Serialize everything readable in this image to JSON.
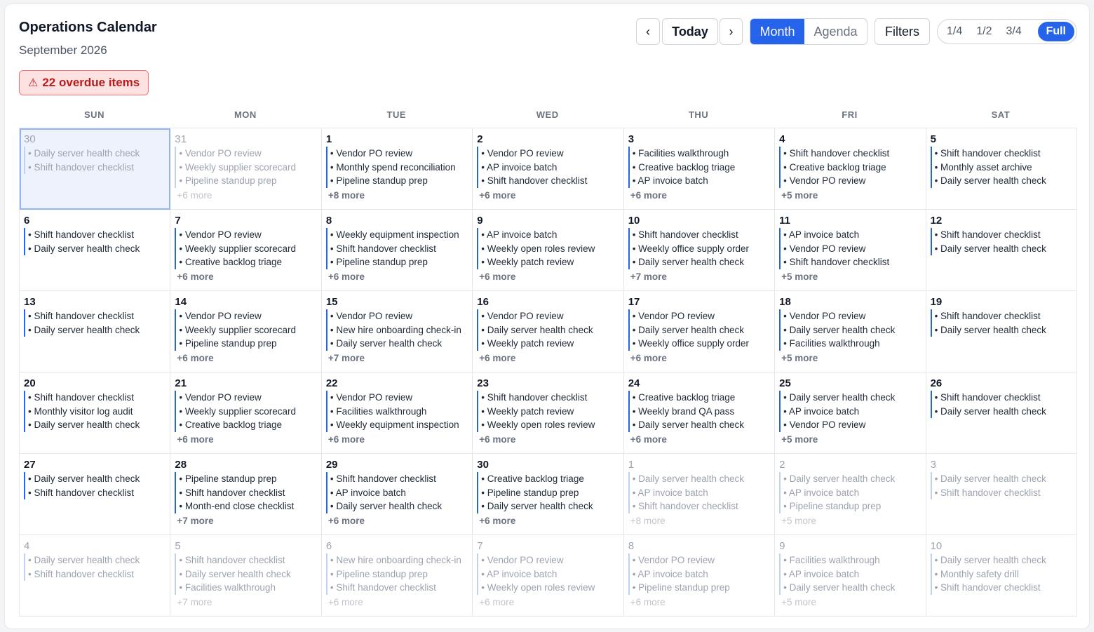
{
  "header": {
    "title": "Operations Calendar",
    "subtitle": "September 2026"
  },
  "alert": {
    "icon": "⚠",
    "text": "22 overdue items"
  },
  "toolbar": {
    "prev": "‹",
    "today": "Today",
    "next": "›",
    "views": [
      "Month",
      "Agenda"
    ],
    "active_view": "Month",
    "filters": "Filters",
    "zoom": [
      "1/4",
      "1/2",
      "3/4",
      "Full"
    ],
    "active_zoom": "Full"
  },
  "colors": {
    "accent": "#2563eb",
    "overdue_bg": "#fee2e2",
    "overdue_text": "#b91c1c"
  },
  "weekdays": [
    "SUN",
    "MON",
    "TUE",
    "WED",
    "THU",
    "FRI",
    "SAT"
  ],
  "days": [
    {
      "d": "30",
      "dim": true,
      "selected": true,
      "events": [
        "Daily server health check",
        "Shift handover checklist"
      ],
      "more": ""
    },
    {
      "d": "31",
      "dim": true,
      "events": [
        "Vendor PO review",
        "Weekly supplier scorecard",
        "Pipeline standup prep"
      ],
      "more": "+6 more"
    },
    {
      "d": "1",
      "events": [
        "Vendor PO review",
        "Monthly spend reconciliation",
        "Pipeline standup prep"
      ],
      "more": "+8 more"
    },
    {
      "d": "2",
      "events": [
        "Vendor PO review",
        "AP invoice batch",
        "Shift handover checklist"
      ],
      "more": "+6 more"
    },
    {
      "d": "3",
      "events": [
        "Facilities walkthrough",
        "Creative backlog triage",
        "AP invoice batch"
      ],
      "more": "+6 more"
    },
    {
      "d": "4",
      "events": [
        "Shift handover checklist",
        "Creative backlog triage",
        "Vendor PO review"
      ],
      "more": "+5 more"
    },
    {
      "d": "5",
      "events": [
        "Shift handover checklist",
        "Monthly asset archive",
        "Daily server health check"
      ],
      "more": ""
    },
    {
      "d": "6",
      "events": [
        "Shift handover checklist",
        "Daily server health check"
      ],
      "more": ""
    },
    {
      "d": "7",
      "events": [
        "Vendor PO review",
        "Weekly supplier scorecard",
        "Creative backlog triage"
      ],
      "more": "+6 more"
    },
    {
      "d": "8",
      "events": [
        "Weekly equipment inspection",
        "Shift handover checklist",
        "Pipeline standup prep"
      ],
      "more": "+6 more"
    },
    {
      "d": "9",
      "events": [
        "AP invoice batch",
        "Weekly open roles review",
        "Weekly patch review"
      ],
      "more": "+6 more"
    },
    {
      "d": "10",
      "events": [
        "Shift handover checklist",
        "Weekly office supply order",
        "Daily server health check"
      ],
      "more": "+7 more"
    },
    {
      "d": "11",
      "events": [
        "AP invoice batch",
        "Vendor PO review",
        "Shift handover checklist"
      ],
      "more": "+5 more"
    },
    {
      "d": "12",
      "events": [
        "Shift handover checklist",
        "Daily server health check"
      ],
      "more": ""
    },
    {
      "d": "13",
      "events": [
        "Shift handover checklist",
        "Daily server health check"
      ],
      "more": ""
    },
    {
      "d": "14",
      "events": [
        "Vendor PO review",
        "Weekly supplier scorecard",
        "Pipeline standup prep"
      ],
      "more": "+6 more"
    },
    {
      "d": "15",
      "events": [
        "Vendor PO review",
        "New hire onboarding check-in",
        "Daily server health check"
      ],
      "more": "+7 more"
    },
    {
      "d": "16",
      "events": [
        "Vendor PO review",
        "Daily server health check",
        "Weekly patch review"
      ],
      "more": "+6 more"
    },
    {
      "d": "17",
      "events": [
        "Vendor PO review",
        "Daily server health check",
        "Weekly office supply order"
      ],
      "more": "+6 more"
    },
    {
      "d": "18",
      "events": [
        "Vendor PO review",
        "Daily server health check",
        "Facilities walkthrough"
      ],
      "more": "+5 more"
    },
    {
      "d": "19",
      "events": [
        "Shift handover checklist",
        "Daily server health check"
      ],
      "more": ""
    },
    {
      "d": "20",
      "events": [
        "Shift handover checklist",
        "Monthly visitor log audit",
        "Daily server health check"
      ],
      "more": ""
    },
    {
      "d": "21",
      "events": [
        "Vendor PO review",
        "Weekly supplier scorecard",
        "Creative backlog triage"
      ],
      "more": "+6 more"
    },
    {
      "d": "22",
      "events": [
        "Vendor PO review",
        "Facilities walkthrough",
        "Weekly equipment inspection"
      ],
      "more": "+6 more"
    },
    {
      "d": "23",
      "events": [
        "Shift handover checklist",
        "Weekly patch review",
        "Weekly open roles review"
      ],
      "more": "+6 more"
    },
    {
      "d": "24",
      "events": [
        "Creative backlog triage",
        "Weekly brand QA pass",
        "Daily server health check"
      ],
      "more": "+6 more"
    },
    {
      "d": "25",
      "events": [
        "Daily server health check",
        "AP invoice batch",
        "Vendor PO review"
      ],
      "more": "+5 more"
    },
    {
      "d": "26",
      "events": [
        "Shift handover checklist",
        "Daily server health check"
      ],
      "more": ""
    },
    {
      "d": "27",
      "events": [
        "Daily server health check",
        "Shift handover checklist"
      ],
      "more": ""
    },
    {
      "d": "28",
      "events": [
        "Pipeline standup prep",
        "Shift handover checklist",
        "Month-end close checklist"
      ],
      "more": "+7 more"
    },
    {
      "d": "29",
      "events": [
        "Shift handover checklist",
        "AP invoice batch",
        "Daily server health check"
      ],
      "more": "+6 more"
    },
    {
      "d": "30",
      "events": [
        "Creative backlog triage",
        "Pipeline standup prep",
        "Daily server health check"
      ],
      "more": "+6 more"
    },
    {
      "d": "1",
      "dim": true,
      "events": [
        "Daily server health check",
        "AP invoice batch",
        "Shift handover checklist"
      ],
      "more": "+8 more"
    },
    {
      "d": "2",
      "dim": true,
      "events": [
        "Daily server health check",
        "AP invoice batch",
        "Pipeline standup prep"
      ],
      "more": "+5 more"
    },
    {
      "d": "3",
      "dim": true,
      "events": [
        "Daily server health check",
        "Shift handover checklist"
      ],
      "more": ""
    },
    {
      "d": "4",
      "dim": true,
      "events": [
        "Daily server health check",
        "Shift handover checklist"
      ],
      "more": ""
    },
    {
      "d": "5",
      "dim": true,
      "events": [
        "Shift handover checklist",
        "Daily server health check",
        "Facilities walkthrough"
      ],
      "more": "+7 more"
    },
    {
      "d": "6",
      "dim": true,
      "events": [
        "New hire onboarding check-in",
        "Pipeline standup prep",
        "Shift handover checklist"
      ],
      "more": "+6 more"
    },
    {
      "d": "7",
      "dim": true,
      "events": [
        "Vendor PO review",
        "AP invoice batch",
        "Weekly open roles review"
      ],
      "more": "+6 more"
    },
    {
      "d": "8",
      "dim": true,
      "events": [
        "Vendor PO review",
        "AP invoice batch",
        "Pipeline standup prep"
      ],
      "more": "+6 more"
    },
    {
      "d": "9",
      "dim": true,
      "events": [
        "Facilities walkthrough",
        "AP invoice batch",
        "Daily server health check"
      ],
      "more": "+5 more"
    },
    {
      "d": "10",
      "dim": true,
      "events": [
        "Daily server health check",
        "Monthly safety drill",
        "Shift handover checklist"
      ],
      "more": ""
    }
  ]
}
